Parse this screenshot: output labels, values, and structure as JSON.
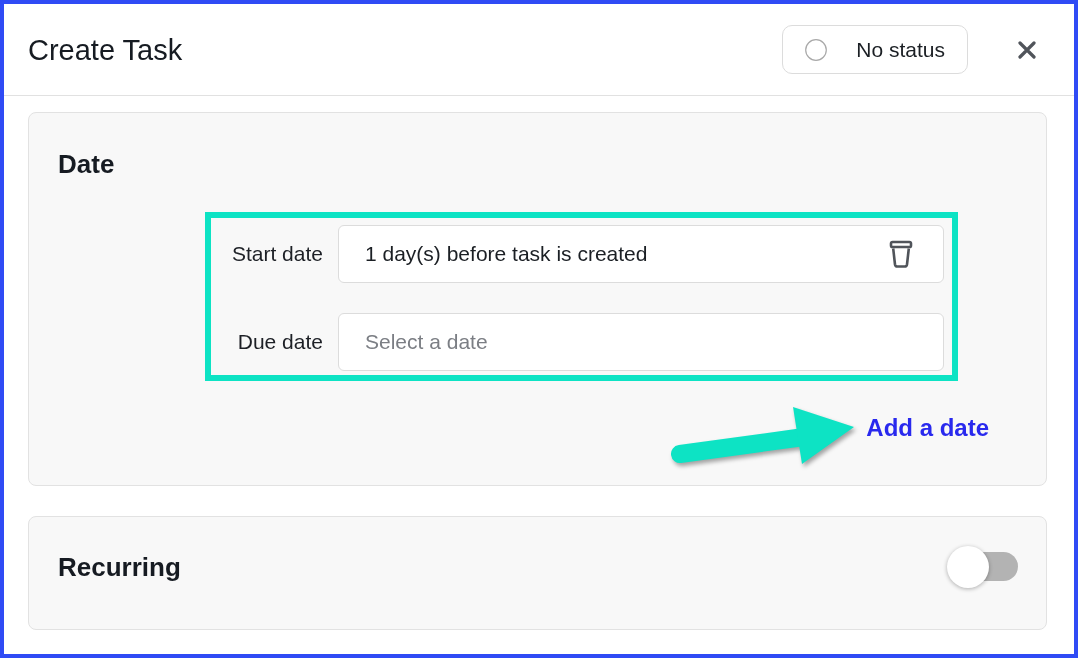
{
  "dialog": {
    "title": "Create Task",
    "status": {
      "label": "No status"
    }
  },
  "date_section": {
    "title": "Date",
    "highlighted": true,
    "fields": [
      {
        "label": "Start date",
        "value": "1 day(s) before task is created",
        "removable": true
      },
      {
        "label": "Due date",
        "placeholder": "Select a date",
        "removable": false
      }
    ],
    "add_link": {
      "label": "Add a date",
      "arrow": true
    }
  },
  "recurring_section": {
    "title": "Recurring",
    "on": false
  }
}
